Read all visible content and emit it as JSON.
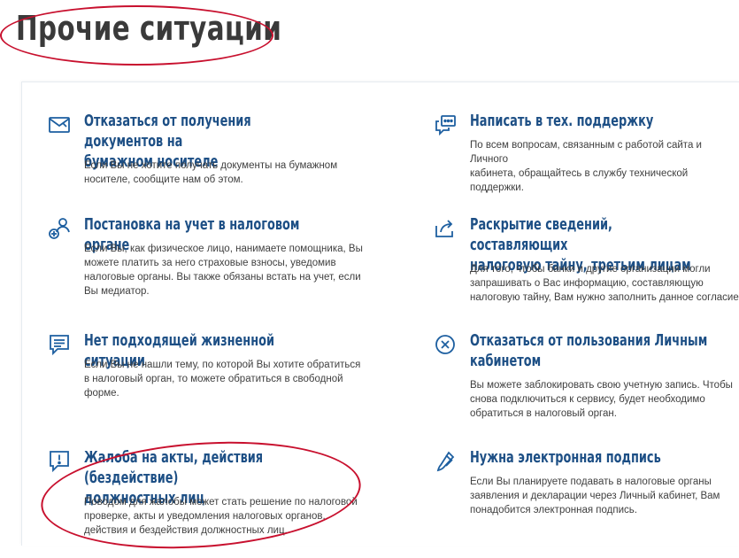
{
  "page_title": "Прочие ситуации",
  "items": [
    {
      "icon": "paper-document-icon",
      "title_lines": [
        "Отказаться от получения документов на",
        "бумажном носителе"
      ],
      "desc_lines": [
        "Если Вы не хотите получать документы на бумажном",
        "носителе, сообщите нам об этом."
      ]
    },
    {
      "icon": "support-chat-icon",
      "title_lines": [
        "Написать в тех. поддержку"
      ],
      "desc_lines": [
        "По всем вопросам, связанным с работой сайта и Личного",
        "кабинета, обращайтесь в службу технической поддержки."
      ]
    },
    {
      "icon": "add-user-icon",
      "title_lines": [
        "Постановка на учет в налоговом органе"
      ],
      "desc_lines": [
        "Если Вы, как физическое лицо, нанимаете помощника, Вы",
        "можете платить за него страховые взносы, уведомив",
        "налоговые органы. Вы также обязаны встать на учет, если",
        "Вы медиатор."
      ]
    },
    {
      "icon": "share-icon",
      "title_lines": [
        "Раскрытие сведений, составляющих",
        "налоговую тайну, третьим лицам"
      ],
      "desc_lines": [
        "Для того, чтобы банки и другие организации могли",
        "запрашивать о Вас информацию, составляющую",
        "налоговую тайну, Вам нужно заполнить данное согласие"
      ]
    },
    {
      "icon": "message-icon",
      "title_lines": [
        "Нет подходящей жизненной ситуации"
      ],
      "desc_lines": [
        "Если Вы не нашли тему, по которой Вы хотите обратиться",
        "в налоговый орган, то можете обратиться в свободной",
        "форме."
      ]
    },
    {
      "icon": "close-circle-icon",
      "title_lines": [
        "Отказаться от пользования Личным",
        "кабинетом"
      ],
      "desc_lines": [
        "Вы можете заблокировать свою учетную запись. Чтобы",
        "снова подключиться к сервису, будет необходимо",
        "обратиться в налоговый орган."
      ]
    },
    {
      "icon": "complaint-icon",
      "title_lines": [
        "Жалоба на акты, действия (бездействие)",
        "должностных лиц"
      ],
      "desc_lines": [
        "Поводом для жалобы может стать решение по налоговой",
        "проверке, акты и уведомления налоговых органов,",
        "действия и бездействия должностных лиц."
      ]
    },
    {
      "icon": "pen-icon",
      "title_lines": [
        "Нужна электронная подпись"
      ],
      "desc_lines": [
        "Если Вы планируете подавать в налоговые органы",
        "заявления и декларации через Личный кабинет, Вам",
        "понадобится электронная подпись."
      ]
    }
  ],
  "colors": {
    "title_blue": "#1d4f85",
    "icon_blue": "#1d5fa0",
    "annotation_red": "#c8102e"
  }
}
